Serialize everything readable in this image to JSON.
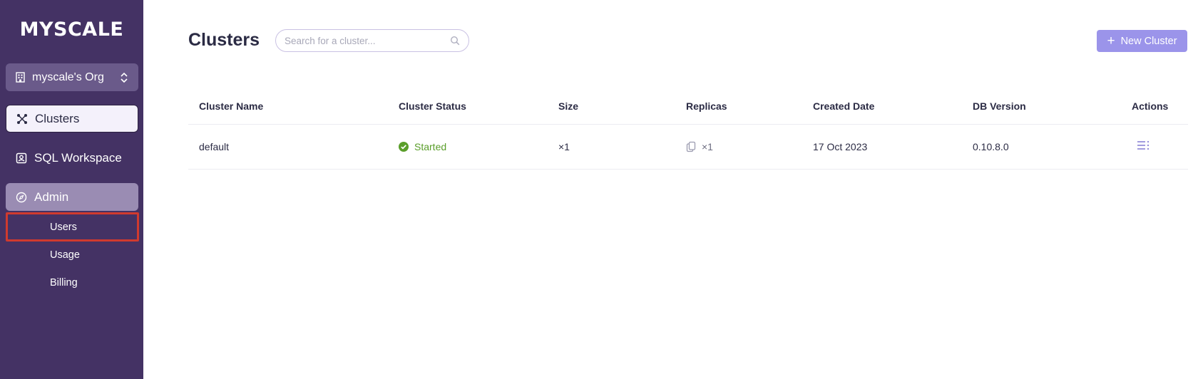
{
  "brand": {
    "logo_text": "MYSCALE"
  },
  "org_switcher": {
    "label": "myscale's Org"
  },
  "sidebar": {
    "items": [
      {
        "label": "Clusters"
      },
      {
        "label": "SQL Workspace"
      },
      {
        "label": "Admin"
      }
    ],
    "admin_subitems": [
      {
        "label": "Users"
      },
      {
        "label": "Usage"
      },
      {
        "label": "Billing"
      }
    ]
  },
  "main": {
    "title": "Clusters",
    "search_placeholder": "Search for a cluster...",
    "new_button_label": "New Cluster"
  },
  "table": {
    "columns": [
      "Cluster Name",
      "Cluster Status",
      "Size",
      "Replicas",
      "Created Date",
      "DB Version",
      "Actions"
    ],
    "rows": [
      {
        "name": "default",
        "status": "Started",
        "size": "×1",
        "replicas": "×1",
        "created": "17 Oct 2023",
        "version": "0.10.8.0"
      }
    ]
  },
  "colors": {
    "sidebar_bg": "#443264",
    "accent": "#9b94ea",
    "status_started": "#5a9e2a",
    "highlight_box": "#d03a2e"
  }
}
